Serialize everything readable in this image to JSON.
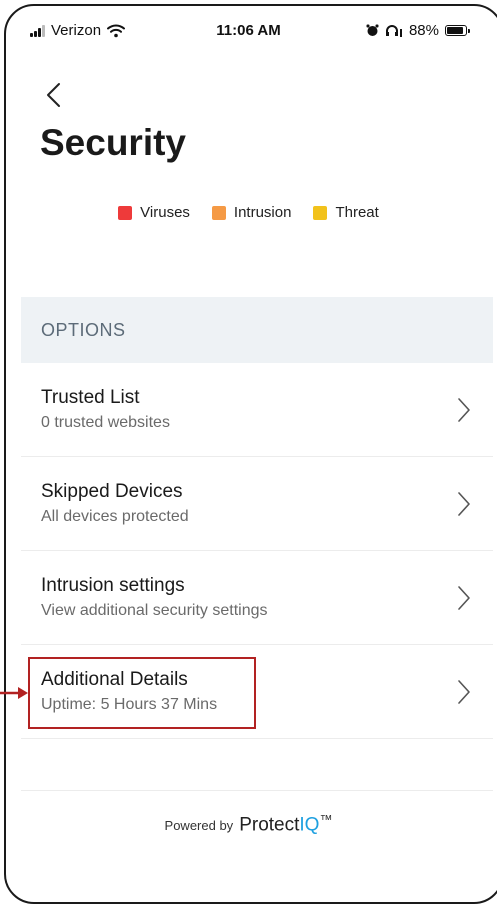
{
  "status_bar": {
    "carrier": "Verizon",
    "time": "11:06 AM",
    "battery_percent": "88%",
    "battery_level": 0.88,
    "icons": [
      "signal-icon",
      "wifi-icon",
      "alarm-icon",
      "headphones-icon",
      "battery-icon"
    ]
  },
  "header": {
    "back_icon": "chevron-left-icon",
    "title": "Security"
  },
  "legend": [
    {
      "label": "Viruses",
      "color": "#ee3a3a"
    },
    {
      "label": "Intrusion",
      "color": "#f59a45"
    },
    {
      "label": "Threat",
      "color": "#f2c21b"
    }
  ],
  "options": {
    "header": "OPTIONS",
    "items": [
      {
        "title": "Trusted List",
        "subtitle": "0 trusted websites"
      },
      {
        "title": "Skipped Devices",
        "subtitle": "All devices protected"
      },
      {
        "title": "Intrusion settings",
        "subtitle": "View additional security settings"
      },
      {
        "title": "Additional Details",
        "subtitle": "Uptime: 5 Hours 37 Mins"
      }
    ]
  },
  "annotation": {
    "color": "#b22222"
  },
  "footer": {
    "powered_by": "Powered by",
    "brand_main": "Protect",
    "brand_accent": "IQ",
    "brand_mark": "™",
    "accent_color": "#1ea0e0"
  }
}
